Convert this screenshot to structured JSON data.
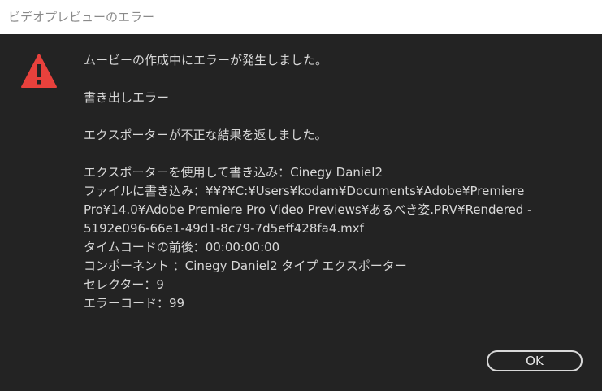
{
  "window": {
    "title": "ビデオプレビューのエラー"
  },
  "icon": {
    "name": "warning-icon",
    "color": "#e8413c"
  },
  "message": {
    "main": "ムービーの作成中にエラーが発生しました。",
    "error_type": "書き出しエラー",
    "exporter_result": "エクスポーターが不正な結果を返しました。",
    "details": [
      "エクスポーターを使用して書き込み：Cinegy Daniel2",
      "ファイルに書き込み：¥¥?¥C:¥Users¥kodam¥Documents¥Adobe¥Premiere",
      "Pro¥14.0¥Adobe Premiere Pro Video Previews¥あるべき姿.PRV¥Rendered -",
      "5192e096-66e1-49d1-8c79-7d5eff428fa4.mxf",
      "タイムコードの前後：00:00:00:00",
      "コンポーネント ：Cinegy Daniel2 タイプ エクスポーター",
      "セレクター：9",
      "エラーコード：99"
    ]
  },
  "buttons": {
    "ok_label": "OK"
  }
}
